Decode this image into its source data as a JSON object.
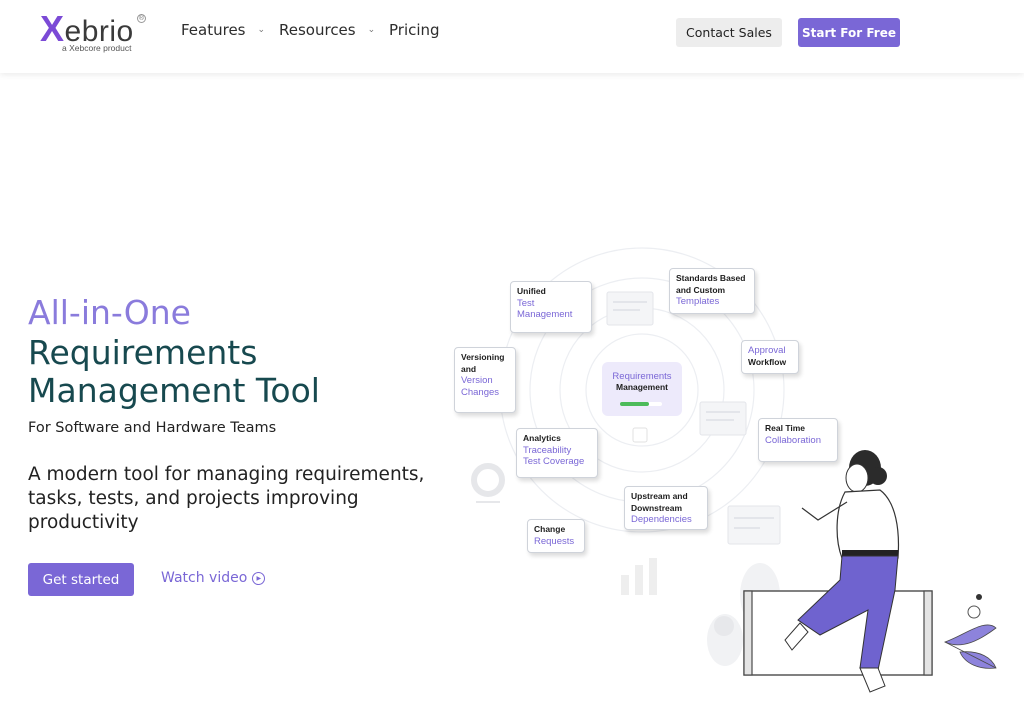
{
  "brand": {
    "name": "ebrio",
    "initial": "X",
    "tagline": "a Xebcore product"
  },
  "nav": {
    "features": "Features",
    "resources": "Resources",
    "pricing": "Pricing",
    "caret": "⌄"
  },
  "actions": {
    "contact": "Contact Sales",
    "start": "Start For Free"
  },
  "hero": {
    "line1": "All-in-One",
    "line2": "Requirements",
    "line3": "Management Tool",
    "sub": "For Software and Hardware Teams",
    "desc": "A modern tool for managing requirements, tasks, tests, and projects improving productivity",
    "cta": "Get started",
    "watch": "Watch video"
  },
  "diagram": {
    "center": {
      "line1": "Requirements",
      "line2": "Management",
      "progress": 0.7
    },
    "cards": {
      "unified": {
        "l1": "Unified",
        "l2": "Test",
        "l3": "Management"
      },
      "standards": {
        "l1": "Standards Based",
        "l2": "and Custom",
        "l3": "Templates"
      },
      "approval": {
        "l1": "Approval",
        "l2": "Workflow"
      },
      "versioning": {
        "l1": "Versioning",
        "l2": "and",
        "l3": "Version",
        "l4": "Changes"
      },
      "realtime": {
        "l1": "Real Time",
        "l2": "Collaboration"
      },
      "analytics": {
        "l1": "Analytics",
        "l2": "Traceability",
        "l3": "Test Coverage"
      },
      "upstream": {
        "l1": "Upstream and",
        "l2": "Downstream",
        "l3": "Dependencies"
      },
      "change": {
        "l1": "Change",
        "l2": "Requests"
      }
    }
  },
  "colors": {
    "accent": "#7a67d6",
    "heading": "#17494f",
    "heading_light": "#8a7bdc",
    "progress": "#4cbb5a"
  }
}
